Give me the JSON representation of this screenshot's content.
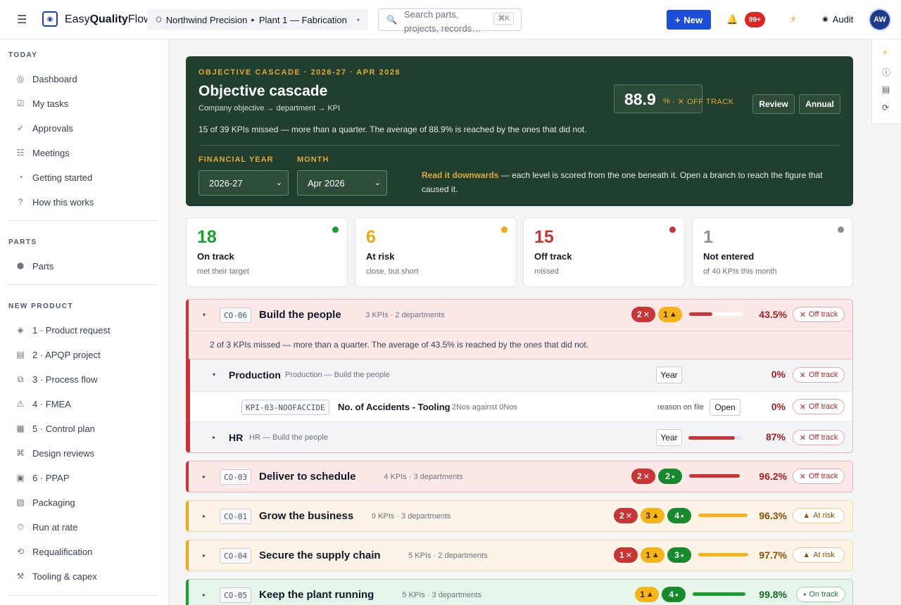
{
  "topbar": {
    "brand_prefix": "Easy",
    "brand_strong": "Quality",
    "brand_suffix": "Flow",
    "plant_org": "Northwind Precision",
    "plant_site": "Plant 1 — Fabrication",
    "search_placeholder": "Search parts, projects, records…",
    "search_shortcut": "⌘K",
    "new_label": "New",
    "notif_count": "99+",
    "audit_label": "Audit",
    "avatar_initials": "AW"
  },
  "sidebar": {
    "sections": [
      {
        "heading": "TODAY",
        "items": [
          {
            "icon": "dashboard-icon",
            "glyph": "◎",
            "label": "Dashboard"
          },
          {
            "icon": "checkbox-icon",
            "glyph": "☑",
            "label": "My tasks"
          },
          {
            "icon": "check-icon",
            "glyph": "✓",
            "label": "Approvals"
          },
          {
            "icon": "list-icon",
            "glyph": "☷",
            "label": "Meetings"
          },
          {
            "icon": "pie-icon",
            "glyph": "◔",
            "label": "Getting started"
          },
          {
            "icon": "question-icon",
            "glyph": "?",
            "label": "How this works"
          }
        ]
      },
      {
        "heading": "PARTS",
        "items": [
          {
            "icon": "hexagon-icon",
            "glyph": "⬢",
            "label": "Parts"
          }
        ]
      },
      {
        "heading": "NEW PRODUCT",
        "items": [
          {
            "icon": "diamond-icon",
            "glyph": "◈",
            "label": "1 · Product request"
          },
          {
            "icon": "document-icon",
            "glyph": "▤",
            "label": "2 · APQP project"
          },
          {
            "icon": "flow-icon",
            "glyph": "⧉",
            "label": "3 · Process flow"
          },
          {
            "icon": "warning-icon",
            "glyph": "⚠",
            "label": "4 · FMEA"
          },
          {
            "icon": "grid-icon",
            "glyph": "▦",
            "label": "5 · Control plan"
          },
          {
            "icon": "command-icon",
            "glyph": "⌘",
            "label": "Design reviews"
          },
          {
            "icon": "square-icon",
            "glyph": "▣",
            "label": "6 · PPAP"
          },
          {
            "icon": "package-icon",
            "glyph": "▧",
            "label": "Packaging"
          },
          {
            "icon": "timer-icon",
            "glyph": "⏱",
            "label": "Run at rate"
          },
          {
            "icon": "refresh-icon",
            "glyph": "⟲",
            "label": "Requalification"
          },
          {
            "icon": "tools-icon",
            "glyph": "⚒",
            "label": "Tooling & capex"
          }
        ]
      }
    ]
  },
  "hero": {
    "eyebrow": "OBJECTIVE CASCADE · 2026-27 · APR 2026",
    "title": "Objective cascade",
    "subtitle": "Company objective → department → KPI",
    "summary": "15 of 39 KPIs missed — more than a quarter. The average of 88.9% is reached by the ones that did not.",
    "score": "88.9",
    "score_unit": "%",
    "score_status": "· ✕ OFF TRACK",
    "review_label": "Review",
    "annual_label": "Annual",
    "fy_label": "FINANCIAL YEAR",
    "fy_value": "2026-27",
    "month_label": "MONTH",
    "month_value": "Apr 2026",
    "hint_strong": "Read it downwards",
    "hint_rest": " — each level is scored from the one beneath it. Open a branch to reach the figure that caused it."
  },
  "summary_cards": [
    {
      "count": "18",
      "label": "On track",
      "sub": "met their target",
      "color": "#18a02f"
    },
    {
      "count": "6",
      "label": "At risk",
      "sub": "close, but short",
      "color": "#f2a60d"
    },
    {
      "count": "15",
      "label": "Off track",
      "sub": "missed",
      "color": "#c83535"
    },
    {
      "count": "1",
      "label": "Not entered",
      "sub": "of 40 KPIs this month",
      "color": "#8a8f96"
    }
  ],
  "objectives": [
    {
      "code": "CO-06",
      "title": "Build the people",
      "meta": "3 KPIs · 2 departments",
      "missed": "2",
      "atrisk": "1",
      "ontrack": null,
      "fill": 0.435,
      "pct": "43.5%",
      "status": "Off track",
      "note": "2 of 3 KPIs missed — more than a quarter. The average of 43.5% is reached by the ones that did not.",
      "departments": [
        {
          "name": "Production",
          "desc": "Production — Build the people",
          "btn": "Year",
          "pct": "0%",
          "status": "Off track",
          "fill": 0,
          "kpis": [
            {
              "code": "KPI-03-NOOFACCIDE",
              "title": "No. of Accidents - Tooling",
              "meta": "2Nos against 0Nos",
              "reason": "reason on file",
              "btn": "Open",
              "pct": "0%",
              "status": "Off track"
            }
          ]
        },
        {
          "name": "HR",
          "desc": "HR — Build the people",
          "btn": "Year",
          "pct": "87%",
          "status": "Off track",
          "fill": 0.87
        }
      ]
    },
    {
      "code": "CO-03",
      "title": "Deliver to schedule",
      "meta": "4 KPIs · 3 departments",
      "missed": "2",
      "atrisk": null,
      "ontrack": "2",
      "fill": 0.962,
      "pct": "96.2%",
      "status": "Off track"
    },
    {
      "code": "CO-01",
      "title": "Grow the business",
      "meta": "9 KPIs · 3 departments",
      "missed": "2",
      "atrisk": "3",
      "ontrack": "4",
      "fill": 0.963,
      "pct": "96.3%",
      "status": "At risk"
    },
    {
      "code": "CO-04",
      "title": "Secure the supply chain",
      "meta": "5 KPIs · 2 departments",
      "missed": "1",
      "atrisk": "1",
      "ontrack": "3",
      "fill": 0.977,
      "pct": "97.7%",
      "status": "At risk"
    },
    {
      "code": "CO-05",
      "title": "Keep the plant running",
      "meta": "5 KPIs · 3 departments",
      "missed": null,
      "atrisk": "1",
      "ontrack": "4",
      "fill": 0.998,
      "pct": "99.8%",
      "status": "On track"
    }
  ]
}
